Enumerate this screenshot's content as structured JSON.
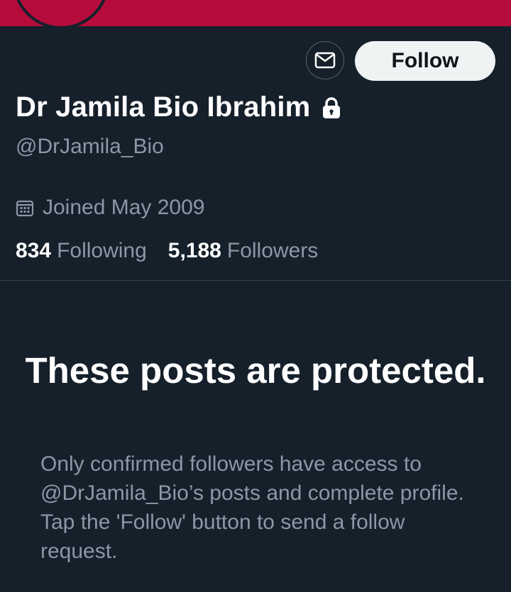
{
  "profile": {
    "name": "Dr Jamila Bio Ibrahim",
    "handle": "@DrJamila_Bio",
    "joined": "Joined May 2009",
    "following_count": "834",
    "following_label": "Following",
    "followers_count": "5,188",
    "followers_label": "Followers"
  },
  "actions": {
    "follow_label": "Follow"
  },
  "protected": {
    "title": "These posts are protected.",
    "description": "Only confirmed followers have access to @DrJamila_Bio’s posts and complete profile. Tap the 'Follow' button to send a follow request."
  },
  "icons": {
    "message": "envelope-icon",
    "lock": "lock-icon",
    "calendar": "calendar-icon"
  },
  "colors": {
    "background": "#15202b",
    "banner": "#b50c3c",
    "secondary_text": "#8b98a5",
    "divider": "#38444d",
    "follow_button_bg": "#eff3f4"
  }
}
